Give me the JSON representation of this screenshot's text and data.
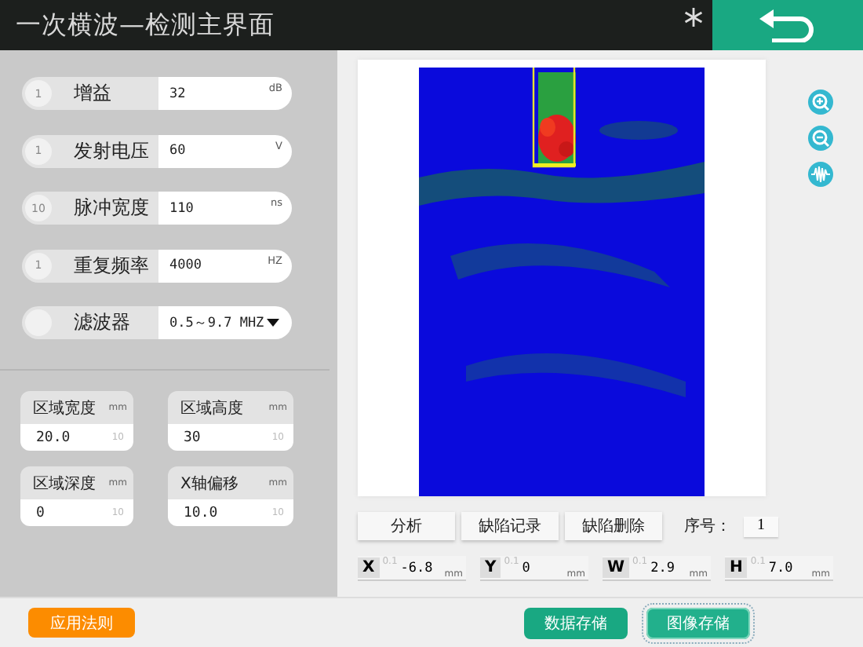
{
  "window": {
    "title": "一次横波—检测主界面"
  },
  "params": [
    {
      "kind": "input",
      "step": "1",
      "label": "增益",
      "value": "32",
      "unit": "dB"
    },
    {
      "kind": "input",
      "step": "1",
      "label": "发射电压",
      "value": "60",
      "unit": "V"
    },
    {
      "kind": "input",
      "step": "10",
      "label": "脉冲宽度",
      "value": "110",
      "unit": "ns"
    },
    {
      "kind": "input",
      "step": "1",
      "label": "重复频率",
      "value": "4000",
      "unit": "HZ"
    },
    {
      "kind": "dropdown",
      "label": "滤波器",
      "value": "0.5～9.7 MHZ"
    }
  ],
  "regions": [
    {
      "label": "区域宽度",
      "unit": "mm",
      "value": "20.0",
      "step": "10"
    },
    {
      "label": "区域高度",
      "unit": "mm",
      "value": "30",
      "step": "10"
    },
    {
      "label": "区域深度",
      "unit": "mm",
      "value": "0",
      "step": "10"
    },
    {
      "label": "X轴偏移",
      "unit": "mm",
      "value": "10.0",
      "step": "10"
    }
  ],
  "actions": [
    "分析",
    "缺陷记录",
    "缺陷删除"
  ],
  "index": {
    "label": "序号：",
    "value": "1"
  },
  "coords": [
    {
      "axis": "X",
      "step": "0.1",
      "value": "-6.8",
      "unit": "mm"
    },
    {
      "axis": "Y",
      "step": "0.1",
      "value": "0",
      "unit": "mm"
    },
    {
      "axis": "W",
      "step": "0.1",
      "value": "2.9",
      "unit": "mm"
    },
    {
      "axis": "H",
      "step": "0.1",
      "value": "7.0",
      "unit": "mm"
    }
  ],
  "footer": {
    "apply": "应用法则",
    "buttons": [
      {
        "label": "数据存储",
        "focused": false
      },
      {
        "label": "图像存储",
        "focused": true
      }
    ]
  }
}
